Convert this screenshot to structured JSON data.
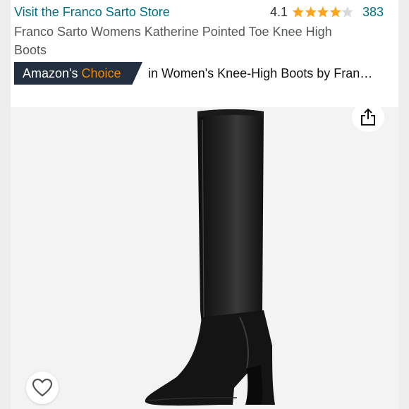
{
  "store": {
    "link_label": "Visit the Franco Sarto Store"
  },
  "rating": {
    "value_text": "4.1",
    "value": 4.1,
    "max": 5,
    "star_fraction": [
      1,
      1,
      1,
      1,
      0.1
    ],
    "review_count": "383",
    "star_color": "#ffa41c",
    "star_empty_color": "#d5d9d9"
  },
  "product": {
    "title": "Franco Sarto Womens Katherine Pointed Toe Knee High Boots"
  },
  "badge": {
    "brand": "Amazon's ",
    "choice": "Choice",
    "category_text": "in Women's Knee-High Boots by Fran…"
  },
  "icons": {
    "share": "share-icon",
    "favorite": "heart-icon"
  },
  "colors": {
    "link": "#007185",
    "badge_bg": "#232f3e",
    "badge_accent": "#f08804"
  }
}
